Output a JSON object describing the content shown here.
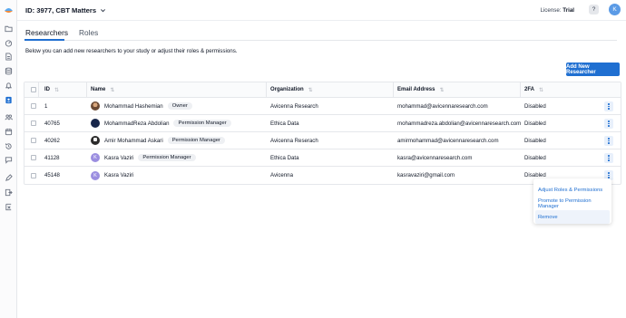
{
  "header": {
    "study_title": "ID: 3977, CBT Matters",
    "license_label": "License:",
    "license_value": "Trial",
    "help_label": "?",
    "user_initial": "K"
  },
  "tabs": [
    {
      "label": "Researchers",
      "active": true
    },
    {
      "label": "Roles",
      "active": false
    }
  ],
  "intro_text": "Below you can add new researchers to your study or adjust their roles & permissions.",
  "add_button_label": "Add New Researcher",
  "table": {
    "columns": [
      "ID",
      "Name",
      "Organization",
      "Email Address",
      "2FA"
    ],
    "rows": [
      {
        "id": "1",
        "name": "Mohammad Hashemian",
        "avatar": "photo",
        "badge": "Owner",
        "organization": "Avicenna Research",
        "email": "mohammad@avicennaresearch.com",
        "twofa": "Disabled"
      },
      {
        "id": "40765",
        "name": "MohammadReza Abdolian",
        "avatar": "photo",
        "badge": "Permission Manager",
        "organization": "Ethica Data",
        "email": "mohammadreza.abdolian@avicennaresearch.com",
        "twofa": "Disabled"
      },
      {
        "id": "40262",
        "name": "Amir Mohammad Askari",
        "avatar": "photo",
        "badge": "Permission Manager",
        "organization": "Avicenna Reserach",
        "email": "amirmohammad@avicennaresearch.com",
        "twofa": "Disabled"
      },
      {
        "id": "41128",
        "name": "Kasra Vaziri",
        "avatar": "K",
        "badge": "Permission Manager",
        "organization": "Ethica Data",
        "email": "kasra@avicennaresearch.com",
        "twofa": "Disabled"
      },
      {
        "id": "45148",
        "name": "Kasra Vaziri",
        "avatar": "K",
        "badge": "",
        "organization": "Avicenna",
        "email": "kasravaziri@gmail.com",
        "twofa": "Disabled"
      }
    ]
  },
  "row_menu": {
    "items": [
      "Adjust Roles & Permissions",
      "Promote to Permission Manager",
      "Remove"
    ],
    "hovered": "Remove"
  },
  "colors": {
    "accent": "#1f6fd1",
    "avatar_letter_bg": "#9b8ee0",
    "user_avatar_bg": "#5b9be6"
  },
  "sidebar_icons": [
    "app-logo",
    "folder-icon",
    "dashboard-icon",
    "document-icon",
    "database-icon",
    "bell-icon",
    "researchers-icon",
    "participants-icon",
    "calendar-icon",
    "history-icon",
    "chat-icon",
    "edit-icon",
    "export-icon",
    "settings-icon"
  ]
}
